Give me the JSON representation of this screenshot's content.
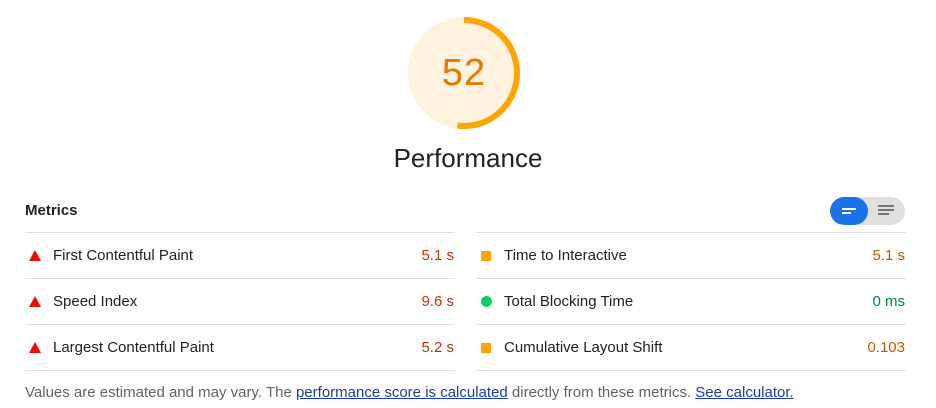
{
  "gauge": {
    "score": "52",
    "label": "Performance",
    "fraction": 0.52,
    "color": "#ffa400"
  },
  "metrics": {
    "title": "Metrics",
    "left": [
      {
        "name": "First Contentful Paint",
        "value": "5.1 s",
        "status": "fail"
      },
      {
        "name": "Speed Index",
        "value": "9.6 s",
        "status": "fail"
      },
      {
        "name": "Largest Contentful Paint",
        "value": "5.2 s",
        "status": "fail"
      }
    ],
    "right": [
      {
        "name": "Time to Interactive",
        "value": "5.1 s",
        "status": "average"
      },
      {
        "name": "Total Blocking Time",
        "value": "0 ms",
        "status": "pass"
      },
      {
        "name": "Cumulative Layout Shift",
        "value": "0.103",
        "status": "average"
      }
    ]
  },
  "toggle": {
    "active": "compact-view",
    "icons": [
      "compact-view-icon",
      "expanded-view-icon"
    ]
  },
  "footnote": {
    "text1": "Values are estimated and may vary. The ",
    "link1": "performance score is calculated",
    "text2": " directly from these metrics. ",
    "link2": "See calculator."
  },
  "colors": {
    "fail": "#eb0f00",
    "average": "#ffa400",
    "pass": "#0cce6b",
    "accent": "#1a73e8"
  }
}
